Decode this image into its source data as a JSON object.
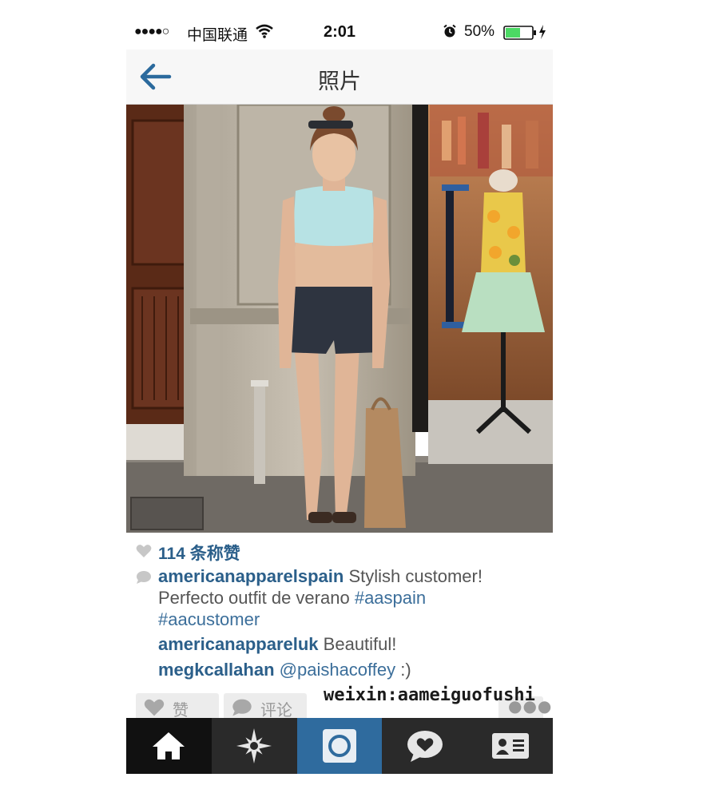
{
  "status_bar": {
    "signal": "●●●●○",
    "carrier": "中国联通",
    "time": "2:01",
    "battery_percent": "50%"
  },
  "nav": {
    "title": "照片"
  },
  "post": {
    "likes": "114 条称赞",
    "comments": [
      {
        "user": "americanapparelspain",
        "text_prefix": "Stylish customer! Perfecto outfit de verano ",
        "tag1": "#aaspain",
        "tag2": "#aacustomer"
      },
      {
        "user": "americanappareluk",
        "text": "Beautiful!"
      },
      {
        "user": "megkcallahan",
        "mention": "@paishacoffey",
        "text": " :)"
      }
    ]
  },
  "actions": {
    "like_label": "赞",
    "comment_label": "评论",
    "more_label": "●●●"
  },
  "watermark": "weixin:aameiguofushi",
  "tabs": [
    "home-icon",
    "explore-icon",
    "camera-icon",
    "news-icon",
    "profile-icon"
  ],
  "colors": {
    "link_blue": "#2b5f8a",
    "tab_active": "#2f6b9e",
    "tab_bar": "#222222",
    "battery_green": "#4cd964"
  }
}
